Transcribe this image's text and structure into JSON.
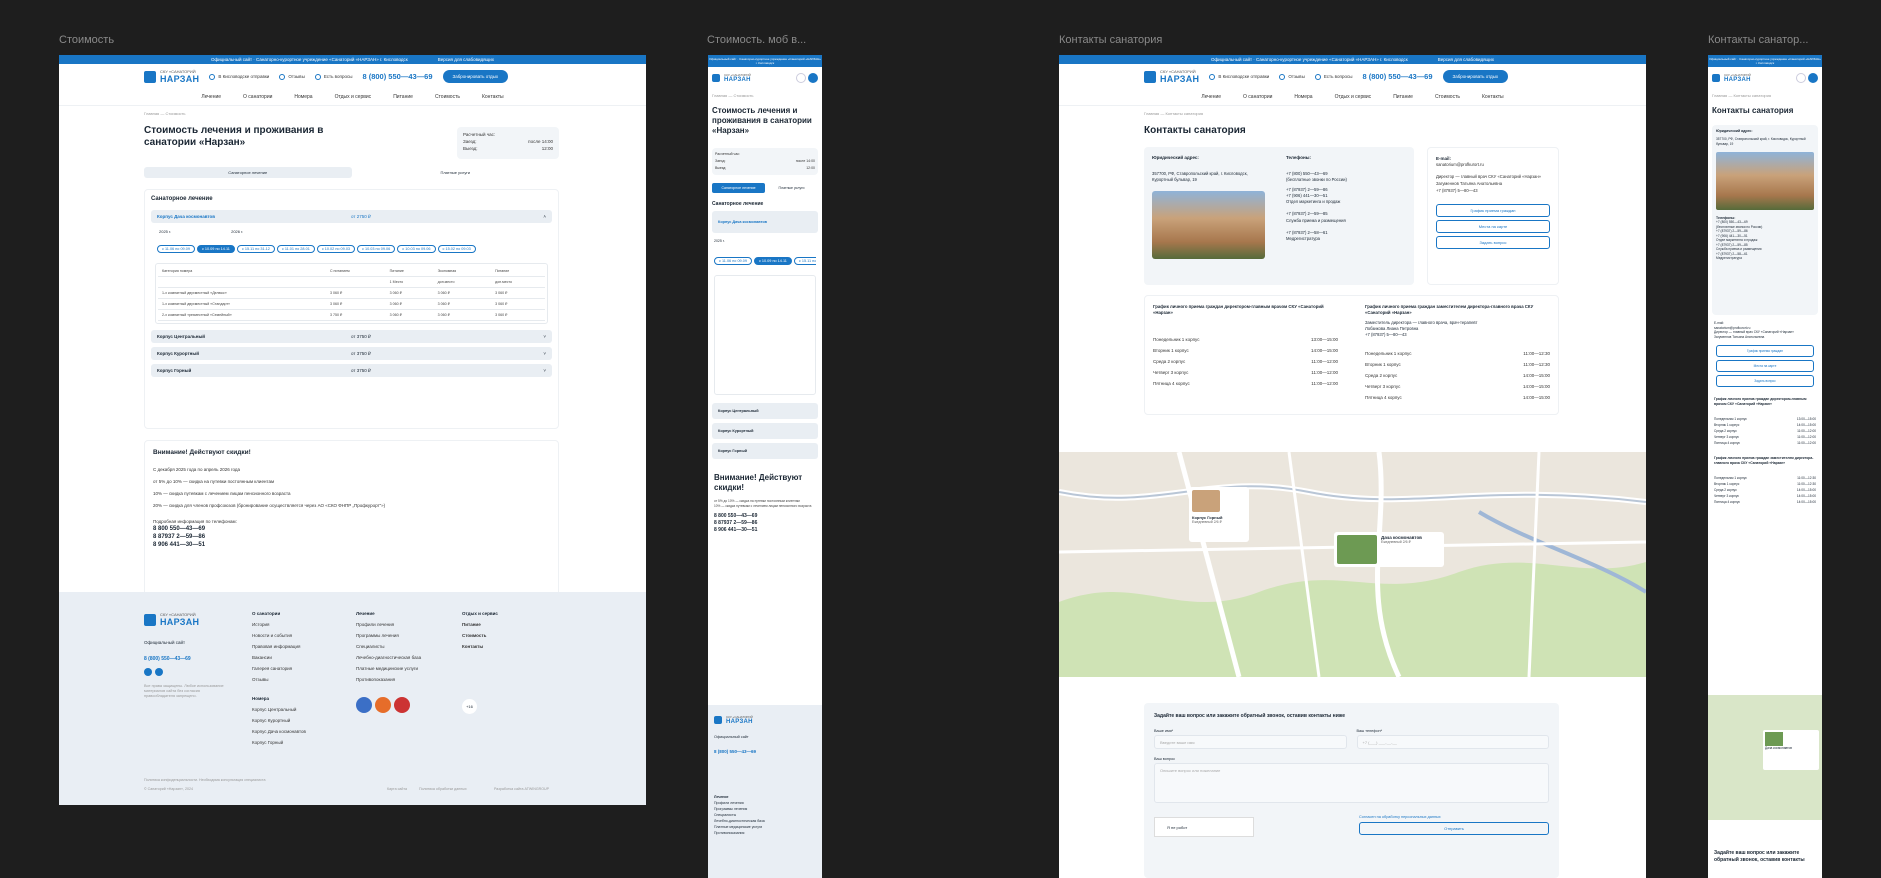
{
  "frames": {
    "f1": "Стоимость",
    "f2": "Стоимость. моб в...",
    "f3": "Контакты санатория",
    "f4": "Контакты санатор..."
  },
  "site": {
    "topbar_left": "Официальный сайт · Санаторно-курортное учреждение «Санаторий «НАРЗАН» г. Кисловодск",
    "topbar_right": "Версия для слабовидящих",
    "logo_small": "СКУ «САНАТОРИЙ",
    "logo_big": "НАРЗАН",
    "chip1": "В Кисловодске отправки",
    "chip2": "Отзывы",
    "chip3": "Есть вопросы",
    "phone": "8 (800) 550—43—69",
    "book": "Забронировать отдых",
    "nav": [
      "Лечение",
      "О санатории",
      "Номера",
      "Отдых и сервис",
      "Питание",
      "Стоимость",
      "Контакты"
    ]
  },
  "price": {
    "crumb": "Главная — Стоимость",
    "title": "Стоимость лечения и проживания в санатории «Нарзан»",
    "hours_label": "Расчетный час:",
    "checkin_label": "Заезд:",
    "checkin": "после 14:00",
    "checkout_label": "Выезд:",
    "checkout": "12:00",
    "tab1": "Санаторное лечение",
    "tab2": "Платные услуги",
    "section": "Санаторное лечение",
    "acc1": "Корпус Дача космонавтов",
    "acc1_price": "от 2750 ₽",
    "year1": "2025 г.",
    "year2": "2026 г.",
    "periods": [
      "с 11.06 по 09.09",
      "с 10.09 по 14.11",
      "с 15.11 по 31.12",
      "с 11.01 по 28.01",
      "с 10.02 по 09.03",
      "с 10.03 по 09.06",
      "с 10.03 по 09.06",
      "с 15.02 по 09.03",
      "с 10.03 по 09.06"
    ],
    "table_head": [
      "Категория номера",
      "С питанием",
      "Питание",
      "Экономная",
      "Питание"
    ],
    "table_sub": [
      "",
      "",
      "1 Место",
      "доп.место",
      "доп.место"
    ],
    "table_rows": [
      [
        "1-х комнатный двухместный «Делюкс»",
        "3 060 ₽",
        "3 060 ₽",
        "3 060 ₽",
        "3 060 ₽"
      ],
      [
        "1-х комнатный двухместный «Стандарт»",
        "3 060 ₽",
        "3 060 ₽",
        "3 060 ₽",
        "3 060 ₽"
      ],
      [
        "2-х комнатный трехместный «Семейный»",
        "3 750 ₽",
        "3 060 ₽",
        "3 060 ₽",
        "3 060 ₽"
      ]
    ],
    "acc2": "Корпус Центральный",
    "acc2_price": "от 3750 ₽",
    "acc3": "Корпус Курортный",
    "acc3_price": "от 3750 ₽",
    "acc4": "Корпус Горный",
    "acc4_price": "от 3750 ₽",
    "sale_title": "Внимание! Действуют скидки!",
    "sale_lines": [
      "С декабря 2025 года по апрель 2026 года",
      "от 5% до 10% — скидка на путевки постоянным клиентам",
      "10% — скидка путевкам с лечением лицам пенсионного возраста",
      "20% — скидка для членов профсоюзов (бронирование осуществляется через АО «СКО ФНПР „Профкурорт“»)",
      "Подробная информация по телефонам:"
    ],
    "phones": [
      "8 800 550—43—69",
      "8 87937 2—59—86",
      "8 906 441—30—51"
    ]
  },
  "footer": {
    "official": "Официальный сайт",
    "phone": "8 (800) 550—43—69",
    "note": "Все права защищены. Любое использование материалов сайта без согласия правообладателя запрещено.",
    "col1_title": "О санатории",
    "col1": [
      "История",
      "Новости и события",
      "Правовая информация",
      "Вакансии",
      "Галерея санатория",
      "Отзывы"
    ],
    "col1b_title": "Номера",
    "col1b": [
      "Корпус Центральный",
      "Корпус Курортный",
      "Корпус Дача космонавтов",
      "Корпус Горный"
    ],
    "col2_title": "Лечение",
    "col2": [
      "Профили лечения",
      "Программы лечения",
      "Специалисты",
      "Лечебно-диагностическая база",
      "Платные медицинские услуги",
      "Противопоказания"
    ],
    "col3": [
      "Отдых и сервис",
      "Питание",
      "Стоимость",
      "Контакты"
    ],
    "age": "+16",
    "bottom1": "Политика конфиденциальности. Необходима консультация специалиста",
    "bottom2": "© Санаторий «Нарзан», 2024",
    "bottom3": "Карта сайта",
    "bottom4": "Политика обработки данных",
    "bottom5": "Разработка сайта ATWINGROUP"
  },
  "contacts": {
    "crumb": "Главная — Контакты санатория",
    "title": "Контакты санатория",
    "legal_label": "Юридический адрес:",
    "legal": "357700, РФ, Ставропольский край, г. Кисловодск, Курортный бульвар, 19",
    "phones_label": "Телефоны:",
    "phones": [
      "+7 (800) 550—43—69",
      "(бесплатные звонки по России)",
      "+7 (87937) 2—59—86",
      "+7 (906) 441—30—51",
      "Отдел маркетинга и продаж",
      "+7 (87937) 2—59—85",
      "Служба приема и размещения",
      "+7 (87937) 2—58—61",
      "Медрегистратура"
    ],
    "email_label": "E-mail:",
    "email": "sanatorium@profkurort.ru",
    "director": "Директор — главный врач СКУ «Санаторий «Нарзан»",
    "director_name": "Загуменнов Татьяна Анатольевна",
    "director_phone": "+7 (87937) 5—80—43",
    "btn1": "График приема граждан",
    "btn2": "Места на карте",
    "btn3": "Задать вопрос",
    "sched1_title": "График личного приема граждан директором-главным врачом СКУ «Санаторий «Нарзан»",
    "sched1": [
      [
        "Понедельник 1 корпус",
        "13:00—15:00"
      ],
      [
        "Вторник 1 корпус",
        "14:00—15:00"
      ],
      [
        "Среда 2 корпус",
        "11:00—12:00"
      ],
      [
        "Четверг 3 корпус",
        "11:00—12:00"
      ],
      [
        "Пятница 4 корпус",
        "11:00—12:00"
      ]
    ],
    "sched2_title": "График личного приема граждан заместителем директора-главного врача СКУ «Санаторий «Нарзан»",
    "sched2_who": "Заместитель директора — главного врача, врач-терапевт",
    "sched2_name": "Лобзикова Лиана Петровна",
    "sched2_phone": "+7 (87937) 5—80—43",
    "sched2": [
      [
        "Понедельник 1 корпус",
        "11:00—12:30"
      ],
      [
        "Вторник 1 корпус",
        "11:00—12:30"
      ],
      [
        "Среда 2 корпус",
        "14:00—15:00"
      ],
      [
        "Четверг 3 корпус",
        "14:00—15:00"
      ],
      [
        "Пятница 4 корпус",
        "14:00—15:00"
      ]
    ],
    "map_pin1": "Корпус Горный",
    "map_pin1b": "Ежедневный 2/6 ₽",
    "map_pin2": "Дача космонавтов",
    "map_pin2b": "Ежедневный 2/6 ₽",
    "form_title": "Задайте ваш вопрос или закажите обратный звонок, оставив контакты ниже",
    "name_label": "Ваше имя*",
    "name_ph": "Введите ваше имя",
    "phone_label": "Ваш телефон*",
    "phone_ph": "+7 (___) ___-__-__",
    "q_label": "Ваш вопрос",
    "q_ph": "Опишите вопрос или пожелание",
    "captcha": "Я не робот",
    "consent": "Согласен на обработку персональных данных",
    "send": "Отправить"
  },
  "mobile": {
    "title": "Стоимость лечения и проживания в санатории «Нарзан»",
    "c_title": "Контакты санатория",
    "sale": "Внимание! Действуют скидки!",
    "form_title": "Задайте ваш вопрос или закажите обратный звонок, оставив контакты"
  }
}
